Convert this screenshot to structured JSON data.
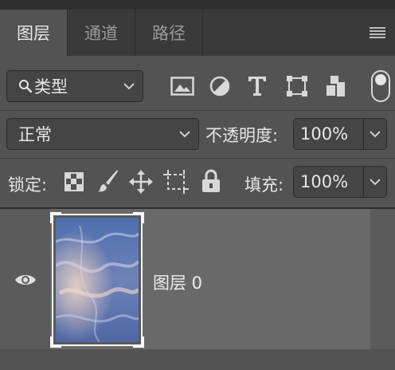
{
  "tabs": [
    {
      "label": "图层",
      "active": true
    },
    {
      "label": "通道",
      "active": false
    },
    {
      "label": "路径",
      "active": false
    }
  ],
  "filter": {
    "label": "类型",
    "filter_icons": [
      "image-filter-icon",
      "adjustment-filter-icon",
      "type-filter-icon",
      "shape-filter-icon",
      "smart-object-filter-icon"
    ]
  },
  "blend": {
    "mode": "正常",
    "opacity_label": "不透明度:",
    "opacity_value": "100%"
  },
  "lock": {
    "label": "锁定:",
    "fill_label": "填充:",
    "fill_value": "100%"
  },
  "layers": [
    {
      "name": "图层 0",
      "visible": true,
      "selected": true
    }
  ],
  "colors": {
    "panel_bg": "#535353",
    "tab_bar_bg": "#3a3a3a",
    "selected_layer_bg": "#696969"
  }
}
